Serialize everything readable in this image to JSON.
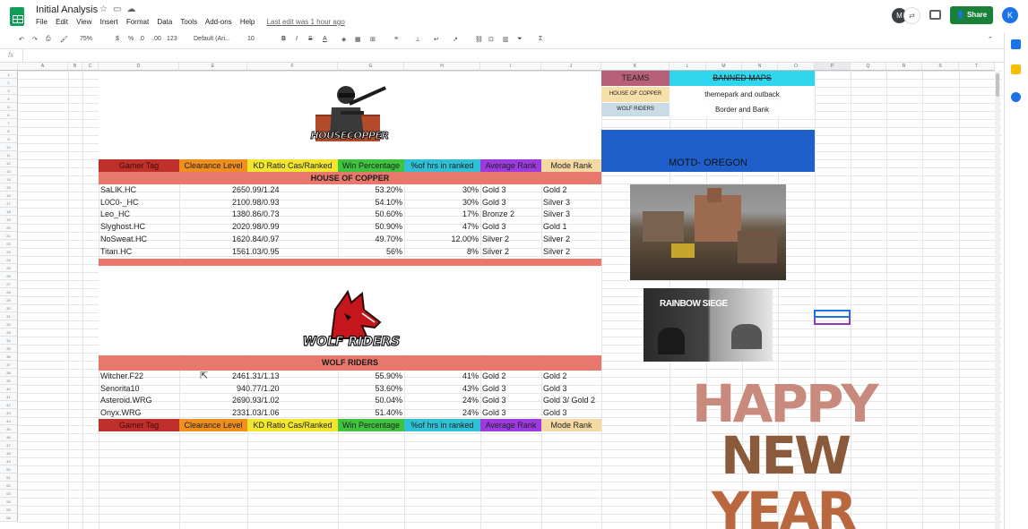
{
  "app": {
    "doc_title": "Initial Analysis",
    "menu": [
      "File",
      "Edit",
      "View",
      "Insert",
      "Format",
      "Data",
      "Tools",
      "Add-ons",
      "Help"
    ],
    "last_edit": "Last edit was 1 hour ago",
    "share_label": "Share",
    "user_initial": "K",
    "collab_initial": "M"
  },
  "toolbar": {
    "zoom": "75%",
    "currency": "$",
    "percent": "%",
    "decimal_less": ".0",
    "decimal_more": ".00",
    "number_format": "123",
    "font": "Default (Ari...",
    "font_size": "10",
    "bold": "B",
    "italic": "I",
    "strike": "S",
    "text_color": "A"
  },
  "formula_bar": {
    "fx": "fx",
    "value": ""
  },
  "columns": [
    "A",
    "B",
    "C",
    "D",
    "E",
    "F",
    "G",
    "H",
    "I",
    "J",
    "K",
    "L",
    "M",
    "N",
    "O",
    "P",
    "Q",
    "R",
    "S",
    "T"
  ],
  "rows": [
    "1",
    "2",
    "3",
    "4",
    "5",
    "6",
    "7",
    "8",
    "9",
    "10",
    "11",
    "12",
    "13",
    "14",
    "15",
    "16",
    "17",
    "18",
    "19",
    "20",
    "21",
    "22",
    "23",
    "24",
    "25",
    "26",
    "27",
    "28",
    "29",
    "30",
    "31",
    "32",
    "33",
    "34",
    "35",
    "36",
    "37",
    "38",
    "39",
    "40",
    "41",
    "42",
    "43",
    "44",
    "45",
    "46",
    "47",
    "48",
    "49",
    "50",
    "51",
    "52",
    "53",
    "54",
    "55",
    "56"
  ],
  "headers": [
    "Gamer Tag",
    "Clearance Level",
    "KD Ratio Cas/Ranked",
    "Win Percentage",
    "%of hrs in ranked",
    "Average Rank",
    "Mode Rank"
  ],
  "header_colors": [
    "#c0302a",
    "#f08f1e",
    "#f2e52d",
    "#3ec43c",
    "#2fc0d6",
    "#9c3ae0",
    "#f4d9a2"
  ],
  "house_of_copper": {
    "logo_text": "HOUSECOPPER",
    "band_title": "HOUSE OF COPPER",
    "rows": [
      [
        "SaLIK.HC",
        "265",
        "0.99/1.24",
        "53.20%",
        "30%",
        "Gold 3",
        "Gold 2"
      ],
      [
        "L0C0-_HC",
        "210",
        "0.98/0.93",
        "54.10%",
        "30%",
        "Gold 3",
        "Silver 3"
      ],
      [
        "Leo_HC",
        "138",
        "0.86/0.73",
        "50.60%",
        "17%",
        "Bronze 2",
        "Silver 3"
      ],
      [
        "Slyghost.HC",
        "202",
        "0.98/0.99",
        "50.90%",
        "47%",
        "Gold 3",
        "Gold 1"
      ],
      [
        "NoSweat.HC",
        "162",
        "0.84/0.97",
        "49.70%",
        "12.00%",
        "Silver 2",
        "Silver 2"
      ],
      [
        "Titan.HC",
        "156",
        "1.03/0.95",
        "56%",
        "8%",
        "Silver 2",
        "Silver 2"
      ]
    ]
  },
  "wolf_riders": {
    "logo_text": "WOLF RIDERS",
    "band_title": "WOLF RIDERS",
    "rows": [
      [
        "Witcher.F22",
        "246",
        "1.31/1.13",
        "55.90%",
        "41%",
        "Gold 2",
        "Gold 2"
      ],
      [
        "Senorita10",
        "94",
        "0.77/1.20",
        "53.60%",
        "43%",
        "Gold 3",
        "Gold 3"
      ],
      [
        "Asteroid.WRG",
        "269",
        "0.93/1.02",
        "50.04%",
        "24%",
        "Gold 3",
        "Gold 3/ Gold 2"
      ],
      [
        "Onyx.WRG",
        "233",
        "1.03/1.06",
        "51.40%",
        "24%",
        "Gold 3",
        "Gold 3"
      ]
    ]
  },
  "bans": {
    "teams_label": "TEAMS",
    "maps_label": "BANNED MAPS",
    "rows": [
      [
        "HOUSE OF COPPER",
        "themepark and outback"
      ],
      [
        "WOLF RIDERS",
        "Border and Bank"
      ]
    ]
  },
  "motd": "MOTD- OREGON",
  "siege_logo": "RAINBOW SIEGE",
  "new_year": [
    "HAPPY",
    "NEW",
    "YEAR"
  ]
}
